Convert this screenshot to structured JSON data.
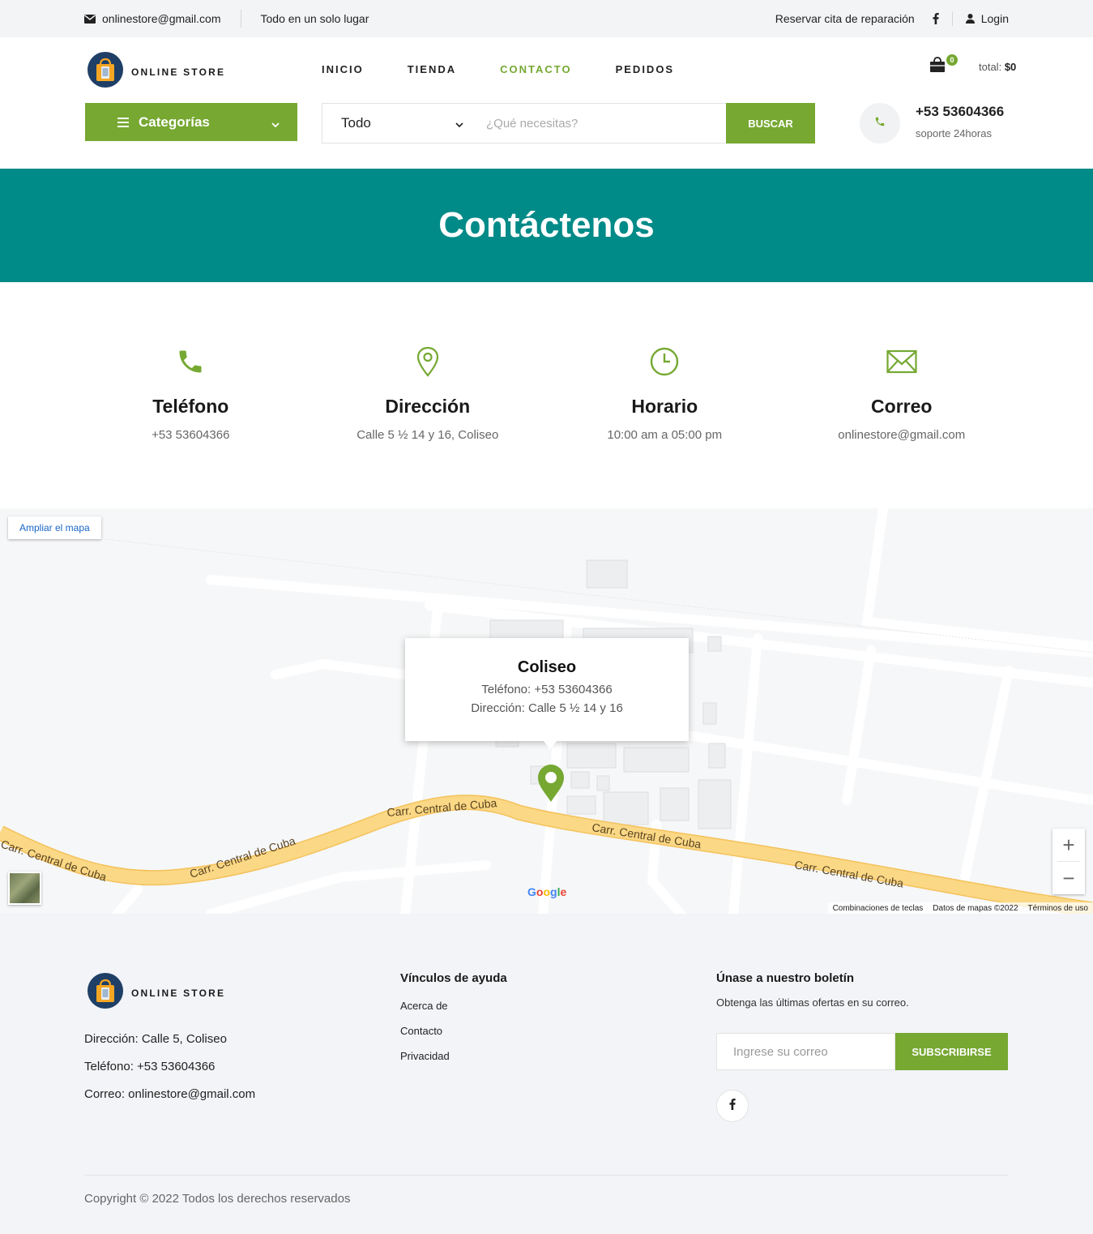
{
  "topbar": {
    "email": "onlinestore@gmail.com",
    "tagline": "Todo en un solo lugar",
    "repair_link": "Reservar cita de reparación",
    "login": "Login"
  },
  "brand": {
    "name": "ONLINE STORE"
  },
  "nav": {
    "items": [
      "INICIO",
      "TIENDA",
      "CONTACTO",
      "PEDIDOS"
    ],
    "active": "CONTACTO"
  },
  "cart": {
    "count": "0",
    "total_label": "total:",
    "total_value": "$0"
  },
  "categories": {
    "label": "Categorías"
  },
  "search": {
    "category": "Todo",
    "placeholder": "¿Qué necesitas?",
    "button": "BUSCAR"
  },
  "support": {
    "phone": "+53 53604366",
    "label": "soporte 24horas"
  },
  "banner": {
    "title": "Contáctenos"
  },
  "contact_cards": [
    {
      "title": "Teléfono",
      "value": "+53 53604366",
      "icon": "phone-icon"
    },
    {
      "title": "Dirección",
      "value": "Calle 5 ½ 14 y 16, Coliseo",
      "icon": "location-pin-icon"
    },
    {
      "title": "Horario",
      "value": "10:00 am a 05:00 pm",
      "icon": "clock-icon"
    },
    {
      "title": "Correo",
      "value": "onlinestore@gmail.com",
      "icon": "envelope-icon"
    }
  ],
  "map": {
    "enlarge": "Ampliar el mapa",
    "info_title": "Coliseo",
    "info_phone": "Teléfono: +53 53604366",
    "info_address": "Dirección: Calle 5 ½ 14 y 16",
    "road_label": "Carr. Central de Cuba",
    "google": "Google",
    "shortcuts": "Combinaciones de teclas",
    "map_data": "Datos de mapas ©2022",
    "terms": "Términos de uso",
    "zoom_in": "+",
    "zoom_out": "−"
  },
  "footer": {
    "address": "Dirección: Calle 5, Coliseo",
    "phone": "Teléfono: +53 53604366",
    "email": "Correo: onlinestore@gmail.com",
    "links_title": "Vínculos de ayuda",
    "links": [
      "Acerca de",
      "Contacto",
      "Privacidad"
    ],
    "newsletter_title": "Únase a nuestro boletín",
    "newsletter_text": "Obtenga las últimas ofertas en su correo.",
    "email_placeholder": "Ingrese su correo",
    "subscribe": "SUBSCRIBIRSE",
    "copyright": "Copyright © 2022 Todos los derechos reservados"
  },
  "colors": {
    "accent": "#76a832",
    "banner": "#008a88",
    "road": "#fbd885"
  }
}
